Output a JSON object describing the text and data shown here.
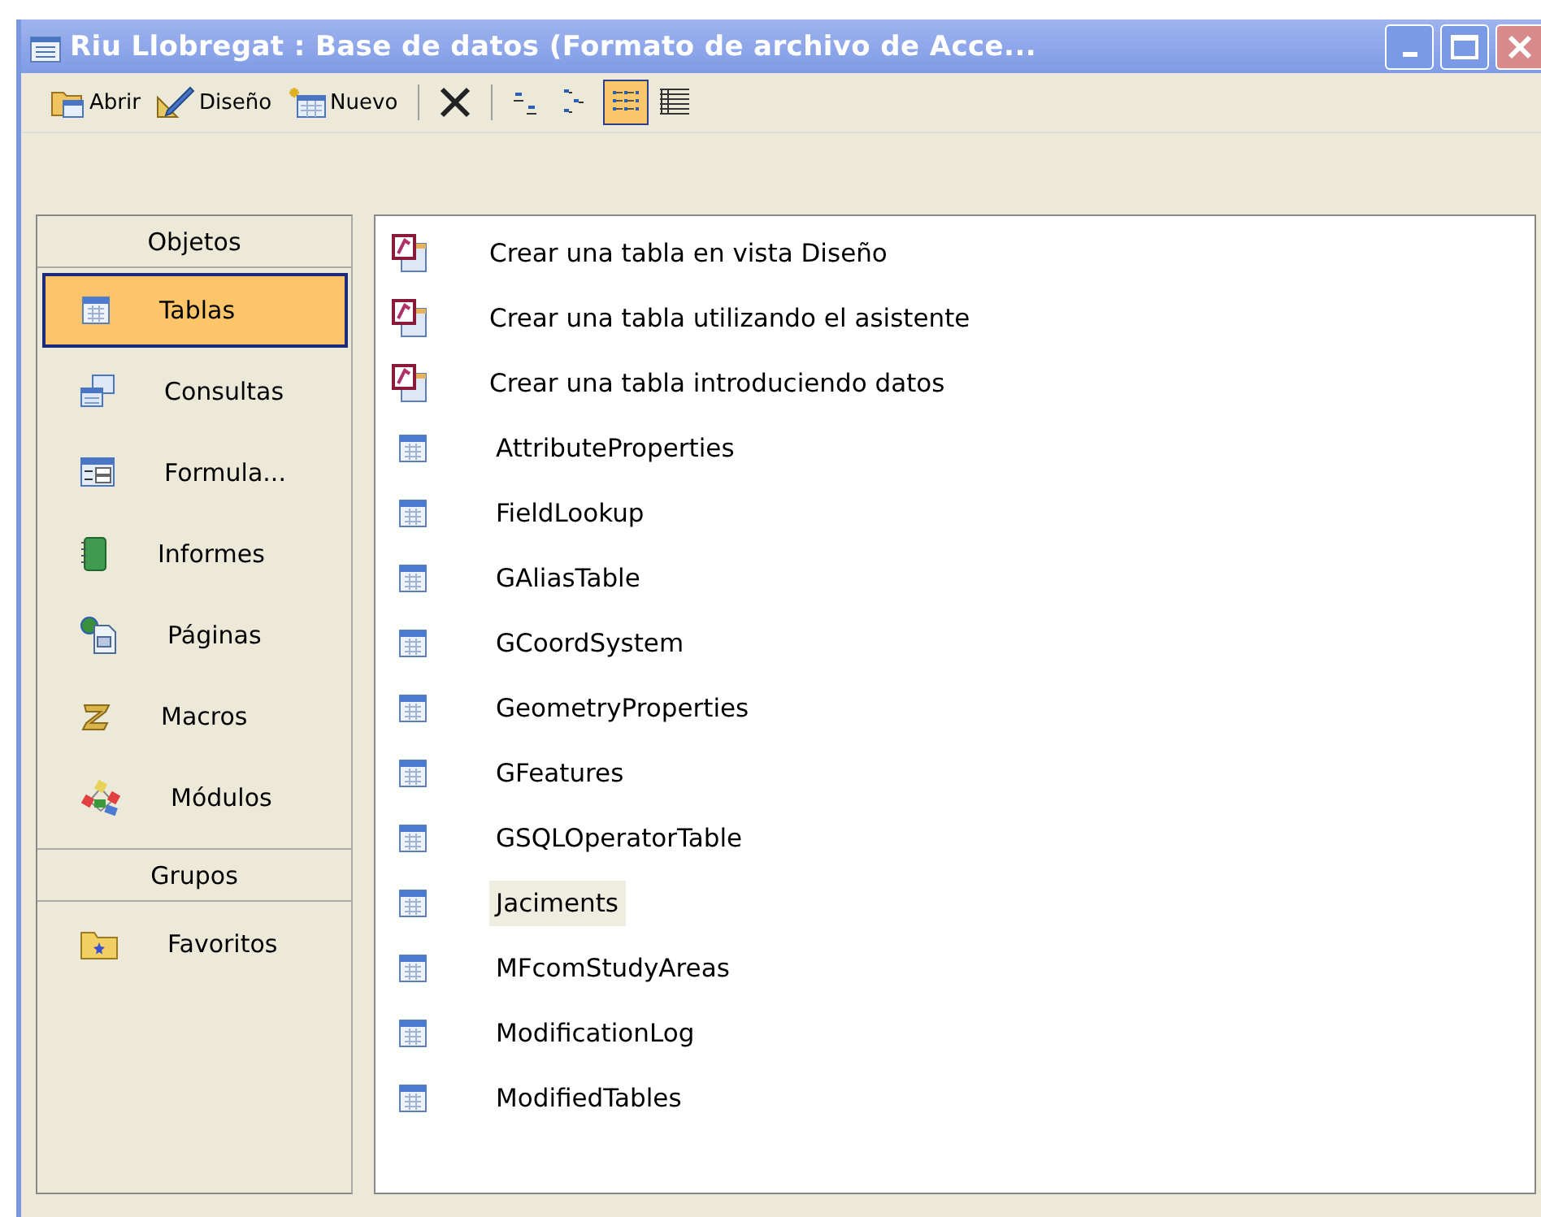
{
  "window": {
    "title": "Riu Llobregat : Base de datos (Formato de archivo de Acce..."
  },
  "toolbar": {
    "buttons": [
      {
        "kind": "open",
        "label": "Abrir"
      },
      {
        "kind": "design",
        "label": "Diseño"
      },
      {
        "kind": "new",
        "label": "Nuevo"
      }
    ],
    "views": [
      {
        "kind": "large",
        "selected": false
      },
      {
        "kind": "small",
        "selected": false
      },
      {
        "kind": "list",
        "selected": true
      },
      {
        "kind": "details",
        "selected": false
      }
    ]
  },
  "sidebar": {
    "sections": [
      {
        "title": "Objetos",
        "items": [
          {
            "kind": "table",
            "label": "Tablas",
            "selected": true
          },
          {
            "kind": "query",
            "label": "Consultas",
            "selected": false
          },
          {
            "kind": "form",
            "label": "Formula...",
            "selected": false
          },
          {
            "kind": "report",
            "label": "Informes",
            "selected": false
          },
          {
            "kind": "page",
            "label": "Páginas",
            "selected": false
          },
          {
            "kind": "macro",
            "label": "Macros",
            "selected": false
          },
          {
            "kind": "module",
            "label": "Módulos",
            "selected": false
          }
        ]
      },
      {
        "title": "Grupos",
        "items": [
          {
            "kind": "favorites",
            "label": "Favoritos",
            "selected": false
          }
        ]
      }
    ]
  },
  "list": {
    "items": [
      {
        "kind": "wizard",
        "label": "Crear una tabla en vista Diseño",
        "highlighted": false
      },
      {
        "kind": "wizard",
        "label": "Crear una tabla utilizando el asistente",
        "highlighted": false
      },
      {
        "kind": "wizard",
        "label": "Crear una tabla introduciendo datos",
        "highlighted": false
      },
      {
        "kind": "table",
        "label": "AttributeProperties",
        "highlighted": false
      },
      {
        "kind": "table",
        "label": "FieldLookup",
        "highlighted": false
      },
      {
        "kind": "table",
        "label": "GAliasTable",
        "highlighted": false
      },
      {
        "kind": "table",
        "label": "GCoordSystem",
        "highlighted": false
      },
      {
        "kind": "table",
        "label": "GeometryProperties",
        "highlighted": false
      },
      {
        "kind": "table",
        "label": "GFeatures",
        "highlighted": false
      },
      {
        "kind": "table",
        "label": "GSQLOperatorTable",
        "highlighted": false
      },
      {
        "kind": "table",
        "label": "Jaciments",
        "highlighted": true
      },
      {
        "kind": "table",
        "label": "MFcomStudyAreas",
        "highlighted": false
      },
      {
        "kind": "table",
        "label": "ModificationLog",
        "highlighted": false
      },
      {
        "kind": "table",
        "label": "ModifiedTables",
        "highlighted": false
      }
    ]
  }
}
